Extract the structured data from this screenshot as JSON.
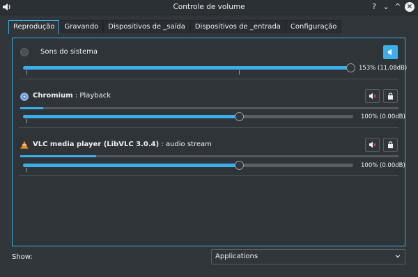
{
  "window": {
    "title": "Controle de volume",
    "buttons": {
      "help": "?",
      "minimize": "⌄",
      "maximize": "^",
      "close": "×"
    }
  },
  "tabs": [
    {
      "label": "Reprodução",
      "active": true
    },
    {
      "label": "Gravando",
      "active": false
    },
    {
      "label": "Dispositivos de _saída",
      "active": false
    },
    {
      "label": "Dispositivos de _entrada",
      "active": false
    },
    {
      "label": "Configuração",
      "active": false
    }
  ],
  "streams": {
    "system": {
      "name": "Sons do sistema",
      "volume_percent": 153,
      "volume_label": "153% (11.08dB)",
      "mute_icon": "speaker-icon",
      "accent": "#3daee9"
    },
    "chromium": {
      "name": "Chromium",
      "detail": ": Playback",
      "volume_percent": 100,
      "volume_label": "100% (0.00dB)",
      "level_fraction": 0.06,
      "mute_icon": "speaker-muted-icon",
      "lock_icon": "lock-icon"
    },
    "vlc": {
      "name": "VLC media player (LibVLC 3.0.4)",
      "detail": ": audio stream",
      "volume_percent": 100,
      "volume_label": "100% (0.00dB)",
      "level_fraction": 0.2,
      "mute_icon": "speaker-muted-icon",
      "lock_icon": "lock-icon"
    }
  },
  "footer": {
    "show_label": "Show:",
    "show_selected": "Applications"
  },
  "colors": {
    "accent": "#3daee9",
    "background": "#31363b"
  }
}
